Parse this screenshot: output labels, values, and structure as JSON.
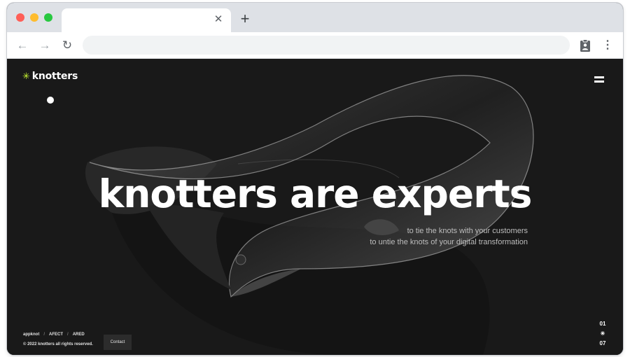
{
  "browser": {
    "tab_close_glyph": "✕",
    "new_tab_glyph": "+",
    "back_glyph": "←",
    "forward_glyph": "→",
    "reload_glyph": "↻",
    "menu_glyph": "⋮",
    "address_value": "",
    "icons": [
      "close-icon",
      "plus-icon",
      "back-arrow-icon",
      "forward-arrow-icon",
      "reload-icon",
      "clipboard-extension-icon",
      "kebab-menu-icon"
    ]
  },
  "site": {
    "logo_mark": "✳",
    "logo_text": "knotters",
    "headline": "knotters are experts",
    "subline_1": "to tie the knots with your customers",
    "subline_2": "to untie the knots of your digital transformation",
    "footer_links": [
      "appknot",
      "AFECT",
      "ARED"
    ],
    "copyright": "© 2022 knotters all rights reserved.",
    "contact_label": "Contact",
    "pager_current": "01",
    "pager_mark": "✳",
    "pager_total": "07",
    "colors": {
      "background": "#191919",
      "accent": "#c6f432",
      "text": "#ffffff"
    }
  }
}
